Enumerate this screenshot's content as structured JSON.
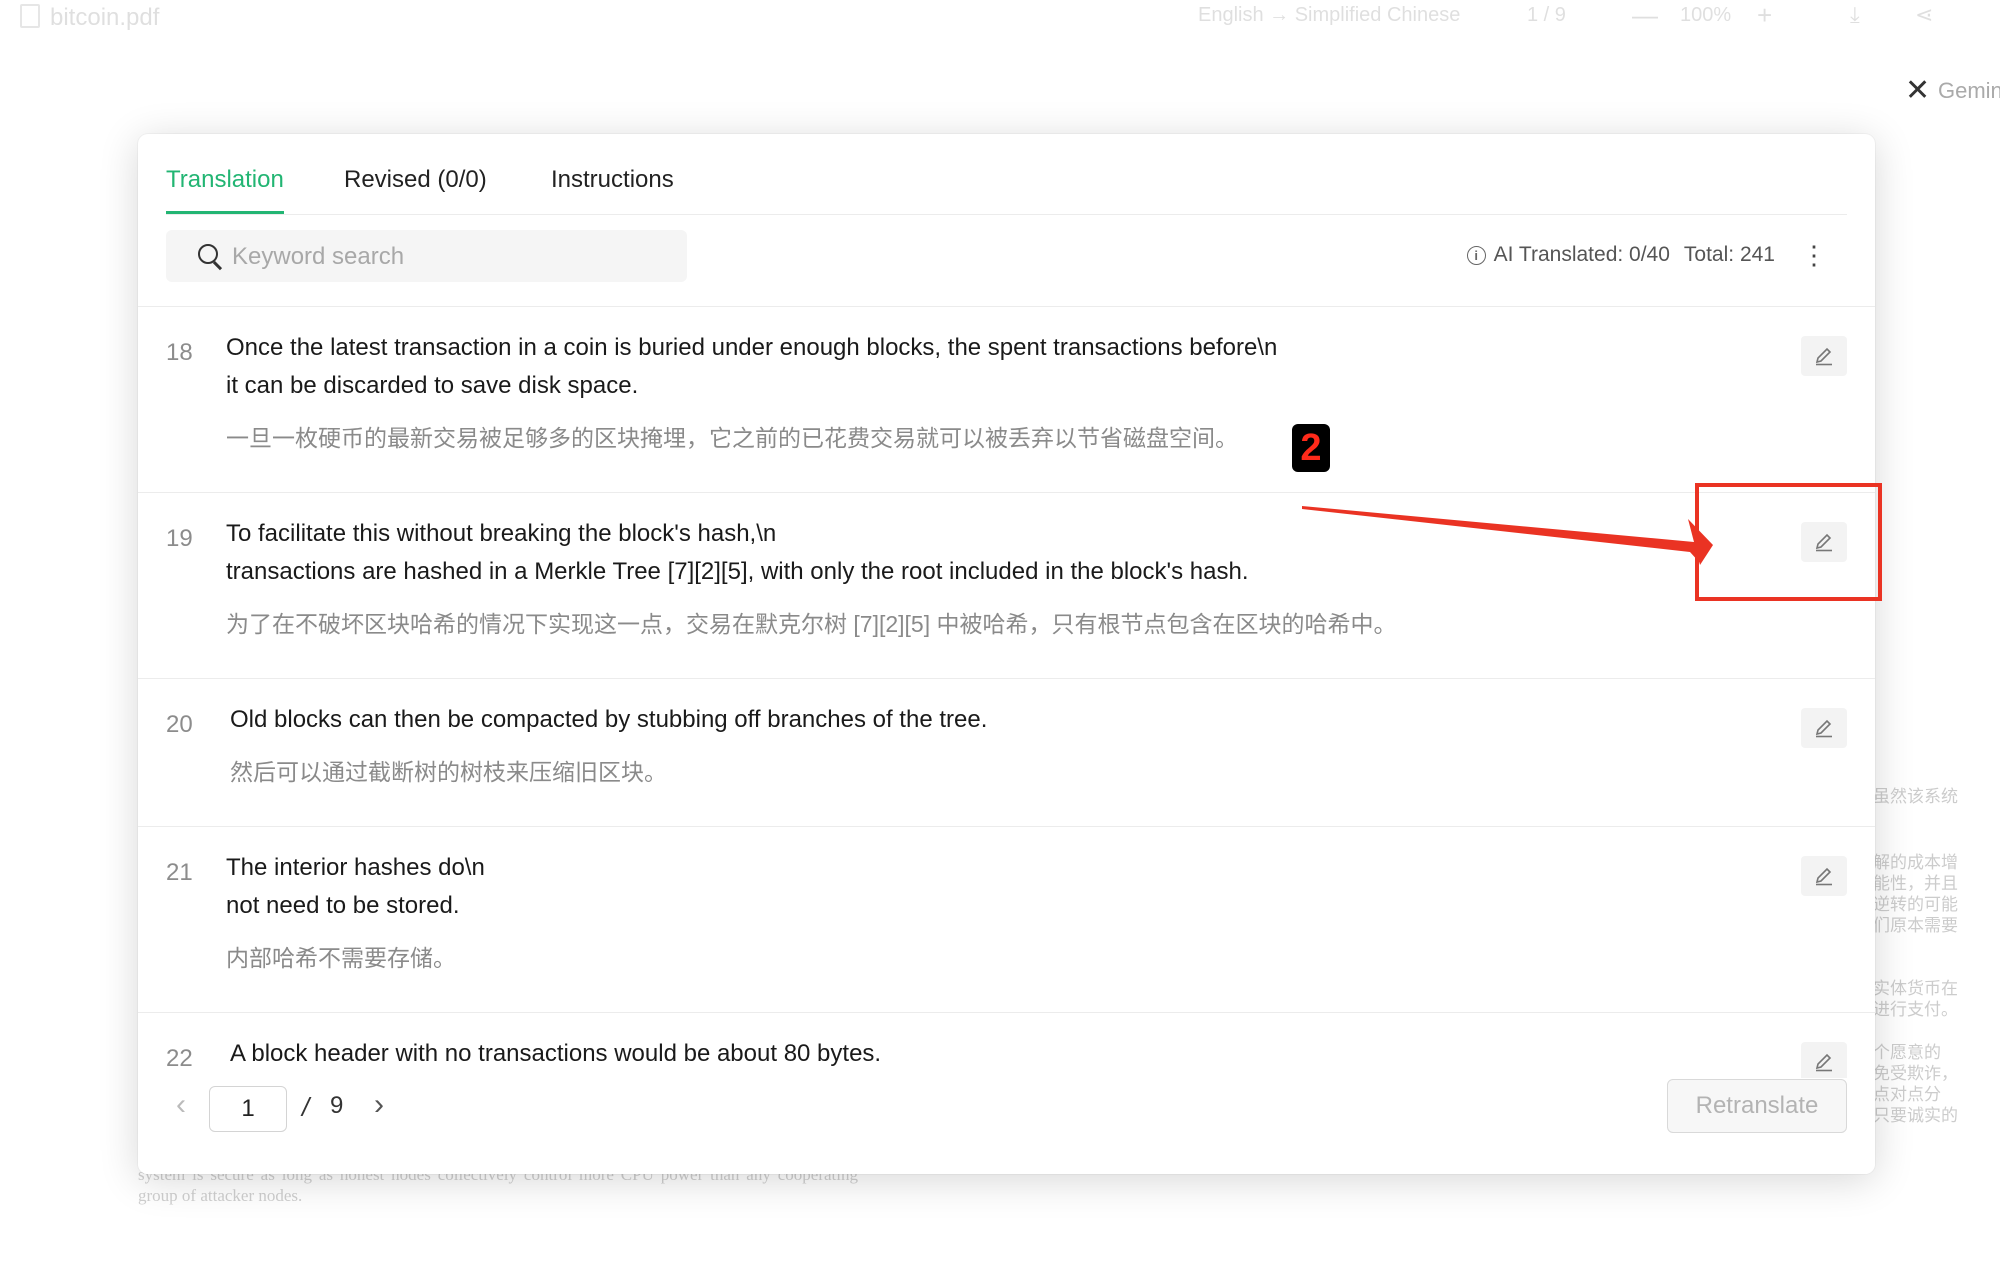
{
  "app": {
    "file_name": "bitcoin.pdf",
    "language_pair": "English → Simplified Chinese",
    "page_indicator": "1 / 9",
    "zoom": "100%",
    "zoom_out": "—",
    "zoom_in": "+",
    "download_icon": "⤓",
    "share_icon": "⋖"
  },
  "gemini": {
    "close_icon": "✕",
    "label": "Gemini"
  },
  "background_text": {
    "side_blocks": [
      [
        "虽然该系统"
      ],
      [
        "解的成本增",
        "能性，并且",
        "逆转的可能",
        "们原本需要"
      ],
      [
        "实体货币在",
        "进行支付。"
      ],
      [
        "个愿意的",
        "免受欺诈，",
        "点对点分",
        "只要诚实的"
      ]
    ],
    "bottom_paragraph": "system is secure as long as honest nodes collectively control more CPU power than any cooperating group of attacker nodes."
  },
  "tabs": [
    {
      "label": "Translation",
      "active": true
    },
    {
      "label": "Revised (0/0)",
      "active": false
    },
    {
      "label": "Instructions",
      "active": false
    }
  ],
  "search": {
    "placeholder": "Keyword search",
    "value": ""
  },
  "stats": {
    "info_icon": "i",
    "ai_translated": "AI Translated: 0/40",
    "total": "Total: 241",
    "more_icon": "⋮"
  },
  "rows": [
    {
      "num": "18",
      "source": "Once the latest transaction in a coin is buried under enough blocks, the spent transactions before\\n\nit can be discarded to save disk space.",
      "translation": "一旦一枚硬币的最新交易被足够多的区块掩埋，它之前的已花费交易就可以被丢弃以节省磁盘空间。"
    },
    {
      "num": "19",
      "source": "To facilitate this without breaking the block's hash,\\n\ntransactions are hashed in a Merkle Tree [7][2][5], with only the root included in the block's hash.",
      "translation": "为了在不破坏区块哈希的情况下实现这一点，交易在默克尔树 [7][2][5] 中被哈希，只有根节点包含在区块的哈希中。"
    },
    {
      "num": "20",
      "source": "Old blocks can then be compacted by stubbing off branches of the tree.",
      "translation": "然后可以通过截断树的树枝来压缩旧区块。"
    },
    {
      "num": "21",
      "source": "The interior hashes do\\n\nnot need to be stored.",
      "translation": "内部哈希不需要存储。"
    },
    {
      "num": "22",
      "source": "A block header with no transactions would be about 80 bytes.",
      "translation": ""
    }
  ],
  "pagination": {
    "prev": "‹",
    "current": "1",
    "separator": "/",
    "total": "9",
    "next": "›"
  },
  "actions": {
    "retranslate": "Retranslate"
  },
  "annotation": {
    "step_number": "2",
    "color": "#ea3323"
  },
  "colors": {
    "accent": "#22b573",
    "annotation_red": "#ea3323"
  }
}
